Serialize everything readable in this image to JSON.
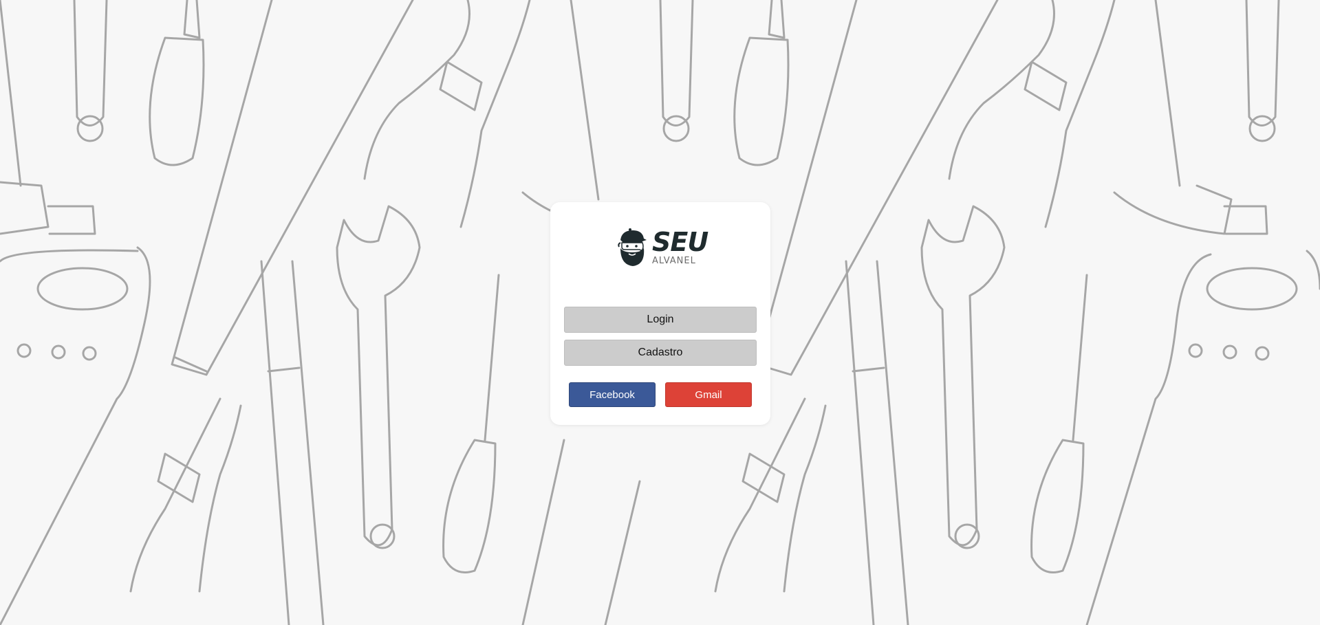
{
  "brand": {
    "name_main": "SEU",
    "name_sub": "ALVANEL",
    "logo_icon": "bearded-man-cap-icon",
    "logo_color": "#1f2b2e"
  },
  "background": {
    "pattern": "hand-drawn tools (hammers, saws, wrenches, pliers, screwdrivers)",
    "color": "#f7f7f7",
    "stroke_color": "#a6a6a6"
  },
  "auth": {
    "login_label": "Login",
    "signup_label": "Cadastro",
    "facebook_label": "Facebook",
    "gmail_label": "Gmail",
    "facebook_color": "#3b5998",
    "gmail_color": "#dd4237"
  }
}
